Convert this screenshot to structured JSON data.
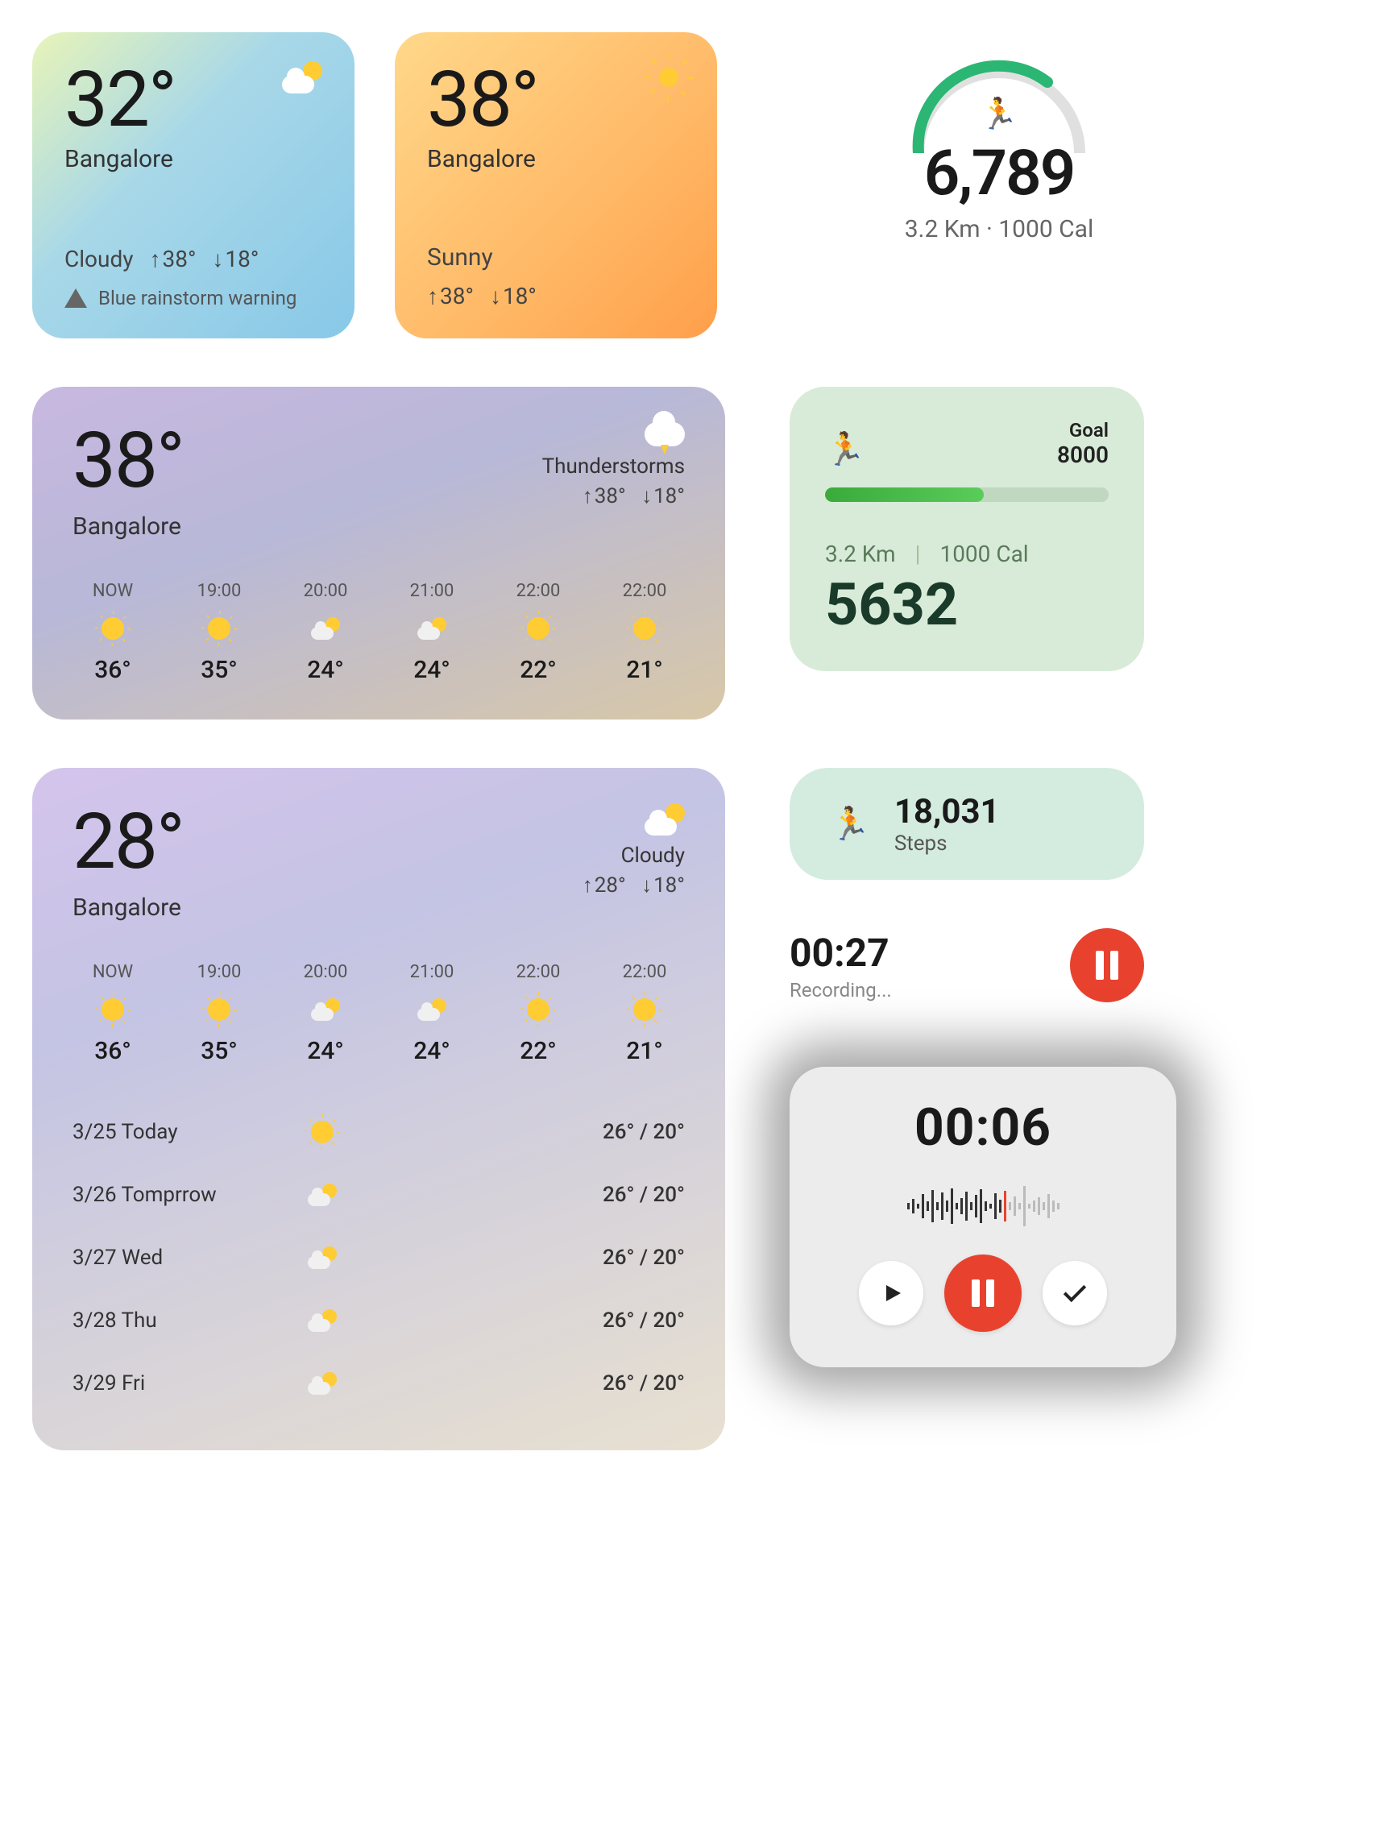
{
  "weather_small_1": {
    "temp": "32°",
    "city": "Bangalore",
    "condition": "Cloudy",
    "high": "38°",
    "low": "18°",
    "warning": "Blue rainstorm warning",
    "icon": "cloud-sun"
  },
  "weather_small_2": {
    "temp": "38°",
    "city": "Bangalore",
    "condition": "Sunny",
    "high": "38°",
    "low": "18°",
    "icon": "sun"
  },
  "steps_ring": {
    "steps": "6,789",
    "sub": "3.2 Km · 1000 Cal",
    "progress_pct": 60
  },
  "weather_wide_1": {
    "temp": "38°",
    "city": "Bangalore",
    "condition": "Thunderstorms",
    "high": "38°",
    "low": "18°",
    "hours": [
      {
        "t": "NOW",
        "icon": "sun",
        "temp": "36°"
      },
      {
        "t": "19:00",
        "icon": "sun",
        "temp": "35°"
      },
      {
        "t": "20:00",
        "icon": "cloud-sun",
        "temp": "24°"
      },
      {
        "t": "21:00",
        "icon": "cloud-sun",
        "temp": "24°"
      },
      {
        "t": "22:00",
        "icon": "sun",
        "temp": "22°"
      },
      {
        "t": "22:00",
        "icon": "sun",
        "temp": "21°"
      }
    ]
  },
  "goal_card": {
    "goal_label": "Goal",
    "goal_value": "8000",
    "progress_pct": 56,
    "distance": "3.2 Km",
    "calories": "1000 Cal",
    "steps": "5632"
  },
  "weather_wide_2": {
    "temp": "28°",
    "city": "Bangalore",
    "condition": "Cloudy",
    "high": "28°",
    "low": "18°",
    "hours": [
      {
        "t": "NOW",
        "icon": "sun",
        "temp": "36°"
      },
      {
        "t": "19:00",
        "icon": "sun",
        "temp": "35°"
      },
      {
        "t": "20:00",
        "icon": "cloud-sun",
        "temp": "24°"
      },
      {
        "t": "21:00",
        "icon": "cloud-sun",
        "temp": "24°"
      },
      {
        "t": "22:00",
        "icon": "sun",
        "temp": "22°"
      },
      {
        "t": "22:00",
        "icon": "sun",
        "temp": "21°"
      }
    ],
    "daily": [
      {
        "d": "3/25 Today",
        "icon": "sun",
        "hl": "26° / 20°"
      },
      {
        "d": "3/26 Tomprrow",
        "icon": "cloud-sun",
        "hl": "26° / 20°"
      },
      {
        "d": "3/27 Wed",
        "icon": "cloud-sun",
        "hl": "26° / 20°"
      },
      {
        "d": "3/28 Thu",
        "icon": "cloud-sun",
        "hl": "26° / 20°"
      },
      {
        "d": "3/29 Fri",
        "icon": "cloud-sun",
        "hl": "26° / 20°"
      }
    ]
  },
  "pill": {
    "steps": "18,031",
    "label": "Steps"
  },
  "recording_row": {
    "time": "00:27",
    "status": "Recording..."
  },
  "recorder_card": {
    "time": "00:06"
  }
}
